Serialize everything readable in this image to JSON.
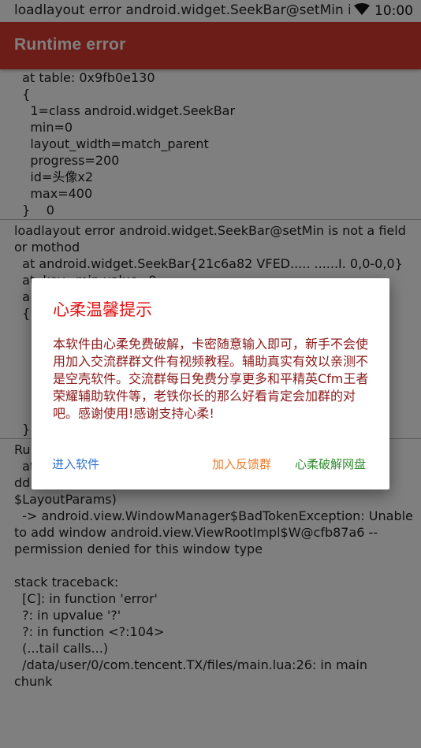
{
  "status_bar": {
    "notification_text": "loadlayout error android.widget.SeekBar@setMin is not a field",
    "time": "10:00",
    "icons": [
      "wifi-icon"
    ]
  },
  "app_bar": {
    "title": "Runtime error"
  },
  "log": {
    "lines": [
      "  at table: 0x9fb0e130",
      "  {",
      "    1=class android.widget.SeekBar",
      "    min=0",
      "    layout_width=match_parent",
      "    progress=200",
      "    id=头像x2",
      "    max=400",
      "  }    0",
      "loadlayout error android.widget.SeekBar@setMin is not a field",
      "or mothod",
      "  at android.widget.SeekBar{21c6a82 VFED..... ......I. 0,0-0,0}",
      "  at  key=min value=0",
      "  a",
      "  {",
      "  }",
      "Ru",
      "  at",
      "dd",
      "$LayoutParams)",
      "  -> android.view.WindowManager$BadTokenException: Unable",
      "to add window android.view.ViewRootImpl$W@cfb87a6 --",
      "permission denied for this window type",
      "",
      "stack traceback:",
      "  [C]: in function 'error'",
      "  ?: in upvalue '?'",
      "  ?: in function <?:104>",
      "  (...tail calls...)",
      "  /data/user/0/com.tencent.TX/files/main.lua:26: in main",
      "chunk"
    ]
  },
  "dialog": {
    "title": "心柔温馨提示",
    "message": "本软件由心柔免费破解，卡密随意输入即可，新手不会使用加入交流群群文件有视频教程。辅助真实有效以亲测不是空壳软件。交流群每日免费分享更多和平精英Cfm王者荣耀辅助软件等，老铁你长的那么好看肯定会加群的对吧。感谢使用!感谢支持心柔!",
    "buttons": {
      "enter": "进入软件",
      "join_group": "加入反馈群",
      "website": "心柔破解网盘"
    }
  },
  "colors": {
    "app_bar": "#d93a2f",
    "dialog_title": "#e21111",
    "dialog_message": "#8b1a1a",
    "btn_enter": "#2d6fd1",
    "btn_group": "#ef7b2b",
    "btn_site": "#2e8b2e"
  }
}
